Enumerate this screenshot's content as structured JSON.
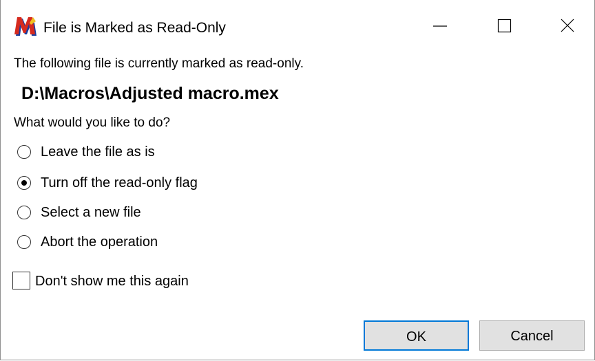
{
  "window": {
    "title": "File is Marked as Read-Only",
    "app_icon": "m-logo-icon",
    "controls": {
      "minimize": "minimize-icon",
      "maximize": "maximize-icon",
      "close": "close-icon"
    }
  },
  "dialog": {
    "message": "The following file is currently marked as read-only.",
    "file_path": "D:\\Macros\\Adjusted macro.mex",
    "question": "What would you like to do?",
    "options": [
      {
        "label": "Leave the file as is",
        "selected": false
      },
      {
        "label": "Turn off the read-only flag",
        "selected": true
      },
      {
        "label": "Select a new file",
        "selected": false
      },
      {
        "label": "Abort the operation",
        "selected": false
      }
    ],
    "dont_show_again": {
      "label": "Don't show me this again",
      "checked": false
    },
    "buttons": {
      "ok": "OK",
      "cancel": "Cancel"
    }
  },
  "colors": {
    "default_button_border": "#0078d7",
    "button_face": "#e1e1e1",
    "icon_red": "#d62a1e",
    "icon_blue": "#1a3c9e"
  }
}
